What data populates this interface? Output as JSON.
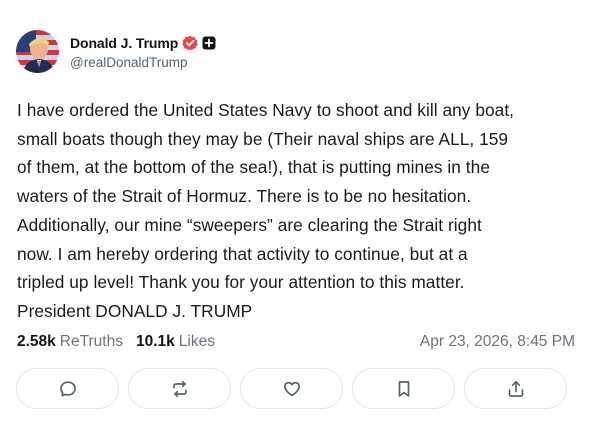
{
  "post": {
    "author": {
      "display_name": "Donald J. Trump",
      "handle": "@realDonaldTrump",
      "avatar_icon": "flag-portrait-avatar",
      "badges": [
        "verified-check-icon",
        "plus-square-icon"
      ]
    },
    "body": "I have ordered the United States Navy to shoot and kill any boat,\nsmall boats though they may be (Their naval ships are ALL, 159\nof them, at the bottom of the sea!), that is putting mines in the\nwaters of the Strait of Hormuz. There is to be no hesitation.\nAdditionally, our mine “sweepers” are clearing the Strait right\nnow. I am hereby ordering that activity to continue, but at a\ntripled up level! Thank you for your attention to this matter.\nPresident DONALD J. TRUMP",
    "stats": {
      "retruths_count": "2.58k",
      "retruths_label": "ReTruths",
      "likes_count": "10.1k",
      "likes_label": "Likes"
    },
    "timestamp": "Apr 23, 2026, 8:45 PM"
  },
  "actions": [
    {
      "name": "reply",
      "icon": "comment-icon"
    },
    {
      "name": "retruth",
      "icon": "retruth-icon"
    },
    {
      "name": "like",
      "icon": "heart-icon"
    },
    {
      "name": "bookmark",
      "icon": "bookmark-icon"
    },
    {
      "name": "share",
      "icon": "share-icon"
    }
  ],
  "colors": {
    "verified": "#e5484d",
    "text_primary": "#0f1419",
    "text_secondary": "#6b7280",
    "border": "#e3e5e8",
    "icon": "#536471"
  }
}
